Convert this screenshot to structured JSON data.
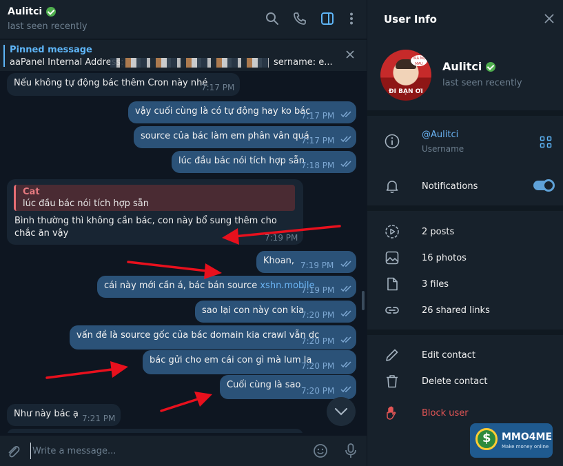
{
  "chat": {
    "title": "Aulitci",
    "status": "last seen recently",
    "pinned": {
      "label": "Pinned message",
      "text": "aaPanel Internal Address:",
      "text_tail": "sername: e..."
    },
    "messages": [
      {
        "direction": "in",
        "text": "Nếu không tự động bác thêm Cron này nhé",
        "time": "7:17 PM"
      },
      {
        "direction": "out",
        "text": "vậy cuối cùng là có tự động hay ko bác",
        "time": "7:17 PM"
      },
      {
        "direction": "out",
        "text": "source của bác làm em phân vân quá",
        "time": "7:17 PM"
      },
      {
        "direction": "out",
        "text": "lúc đầu bác nói tích hợp sẵn",
        "time": "7:18 PM"
      },
      {
        "direction": "in",
        "reply_to": {
          "name": "Cat",
          "text": "lúc đầu bác nói tích hợp sẵn"
        },
        "text": "Bình thường thì không cần bác, con này bổ sung thêm cho chắc ăn vậy",
        "time": "7:19 PM"
      },
      {
        "direction": "out",
        "text": "Khoan,",
        "time": "7:19 PM"
      },
      {
        "direction": "out",
        "text": "cái này mới cần á, bác bán source ",
        "link": "xshn.mobile",
        "time": "7:19 PM"
      },
      {
        "direction": "out",
        "text": "sao lại con này con kia",
        "time": "7:20 PM"
      },
      {
        "direction": "out",
        "text": "vấn đề là source gốc của bác domain kia crawl vẫn dc",
        "time": "7:20 PM"
      },
      {
        "direction": "out",
        "text": "bác gửi cho em cái con gì mà lum la",
        "time": "7:20 PM"
      },
      {
        "direction": "out",
        "text": "Cuối cùng là sao",
        "time": "7:20 PM"
      },
      {
        "direction": "in",
        "text": "Như này bác ạ",
        "time": "7:21 PM"
      }
    ],
    "composer": {
      "placeholder": "Write a message..."
    }
  },
  "user_info": {
    "header": "User Info",
    "name": "Aulitci",
    "status": "last seen recently",
    "avatar_caption": "ĐI BẠN ƠI",
    "avatar_bubble": "TRẢ NỢ MAU",
    "username": {
      "value": "@Aulitci",
      "label": "Username"
    },
    "notifications": {
      "label": "Notifications",
      "enabled": true
    },
    "media": [
      {
        "icon": "posts-icon",
        "label": "2 posts"
      },
      {
        "icon": "photos-icon",
        "label": "16 photos"
      },
      {
        "icon": "files-icon",
        "label": "3 files"
      },
      {
        "icon": "link-icon",
        "label": "26 shared links"
      }
    ],
    "actions": {
      "edit": "Edit contact",
      "delete": "Delete contact",
      "block": "Block user"
    }
  },
  "watermark": {
    "title": "MMO4ME",
    "subtitle": "Make money online"
  },
  "colors": {
    "background": "#0e1621",
    "panel": "#17212b",
    "incoming_bubble": "#182533",
    "outgoing_bubble": "#2b5278",
    "accent": "#5eb5f7",
    "danger": "#e25555",
    "annotation_arrow": "#e8101d",
    "verified": "#4fae4e"
  }
}
